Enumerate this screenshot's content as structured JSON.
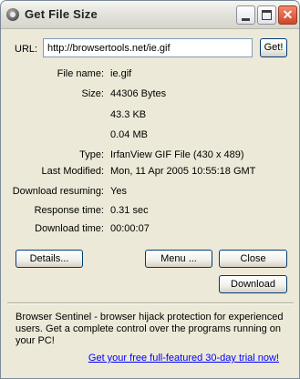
{
  "window": {
    "title": "Get File Size"
  },
  "url": {
    "label": "URL:",
    "value": "http://browsertools.net/ie.gif",
    "button": "Get!"
  },
  "info": [
    {
      "label": "File name:",
      "value": "ie.gif"
    },
    {
      "label": "Size:",
      "value": "44306 Bytes"
    },
    {
      "label": "",
      "value": "43.3 KB"
    },
    {
      "label": "",
      "value": "0.04 MB"
    },
    {
      "label": "Type:",
      "value": "IrfanView GIF File (430 x 489)"
    },
    {
      "label": "Last Modified:",
      "value": "Mon, 11 Apr 2005 10:55:18 GMT"
    },
    {
      "label": "Download resuming:",
      "value": "Yes"
    },
    {
      "label": "Response time:",
      "value": "0.31 sec"
    },
    {
      "label": "Download time:",
      "value": "00:00:07"
    }
  ],
  "buttons": {
    "details": "Details...",
    "menu": "Menu ...",
    "close": "Close",
    "download": "Download"
  },
  "ad": {
    "text": "Browser Sentinel - browser hijack protection for experienced users. Get a complete control over the programs running on your PC!",
    "link": "Get your free full-featured 30-day trial now!"
  }
}
